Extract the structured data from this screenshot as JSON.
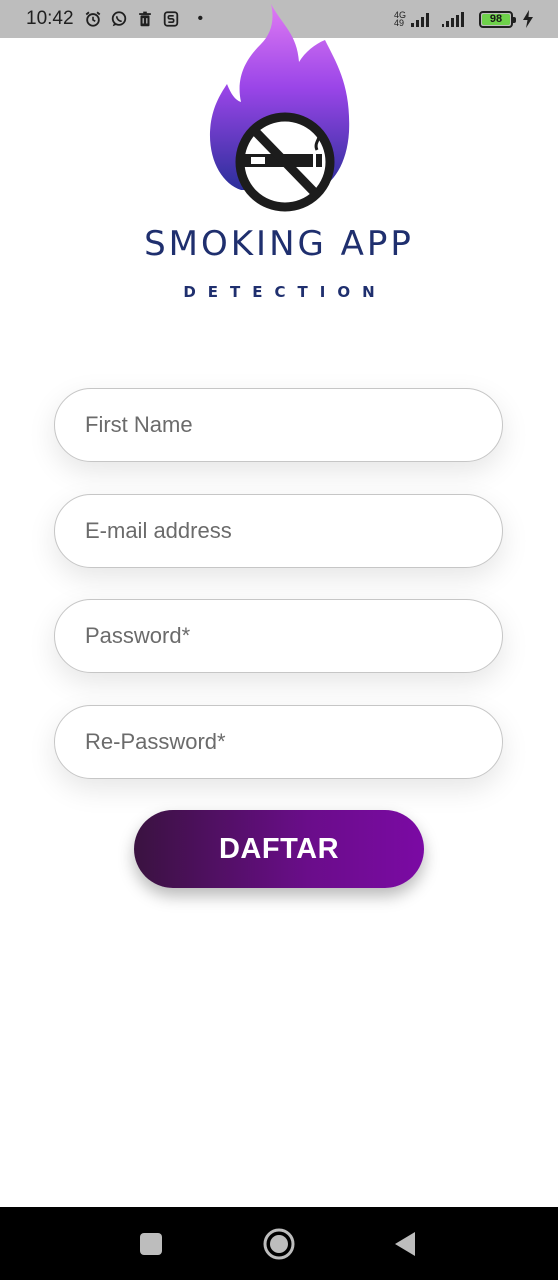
{
  "status_bar": {
    "time": "10:42",
    "network_top": "4G",
    "network_bottom": "49",
    "battery": "98",
    "icons": [
      "alarm-icon",
      "whatsapp-icon",
      "trash-icon",
      "s-app-icon",
      "dot-icon",
      "signal-icon",
      "signal-icon",
      "charging-icon"
    ]
  },
  "logo": {
    "title": "SMOKING APP",
    "subtitle": "DETECTION",
    "colors": {
      "flame_top": "#d66ef2",
      "flame_mid": "#8a3fe0",
      "flame_bottom": "#2b2f9a",
      "text": "#1f2f6e"
    }
  },
  "form": {
    "first_name": {
      "placeholder": "First Name",
      "value": ""
    },
    "email": {
      "placeholder": "E-mail address",
      "value": ""
    },
    "password": {
      "placeholder": "Password*",
      "value": ""
    },
    "repassword": {
      "placeholder": "Re-Password*",
      "value": ""
    },
    "submit_label": "DAFTAR",
    "submit_colors": [
      "#3a1240",
      "#7b0aa4"
    ]
  },
  "nav_bar": {
    "buttons": [
      "recents-icon",
      "home-icon",
      "back-icon"
    ]
  }
}
